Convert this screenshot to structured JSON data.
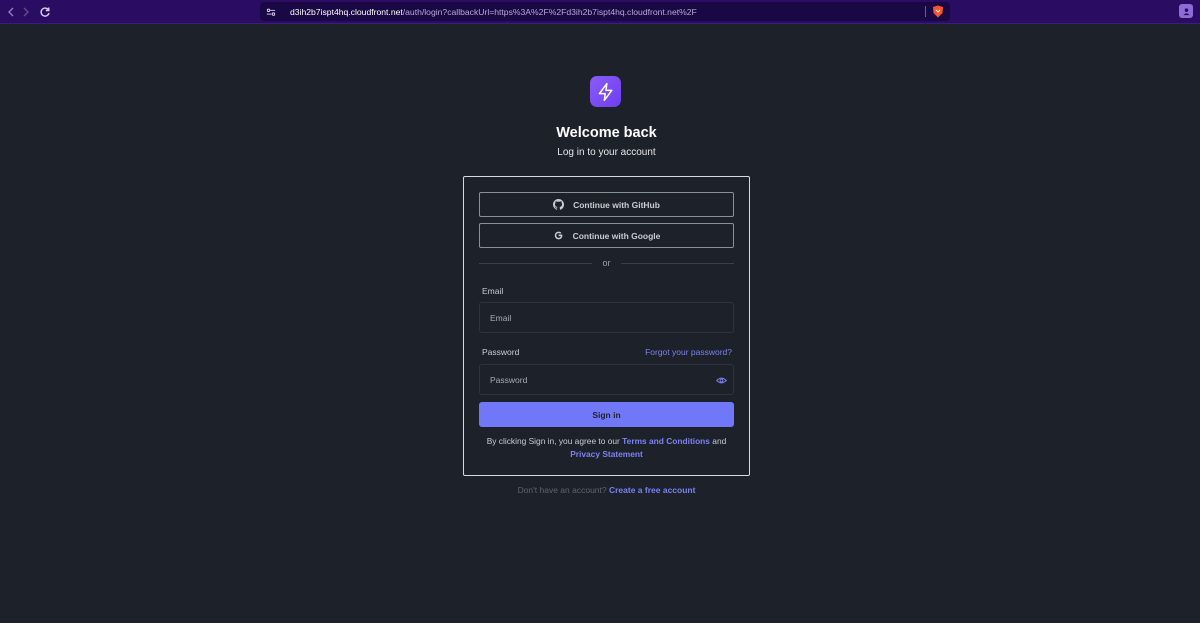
{
  "browser": {
    "url_host": "d3ih2b7ispt4hq.cloudfront.net",
    "url_path": "/auth/login?callbackUrl=https%3A%2F%2Fd3ih2b7ispt4hq.cloudfront.net%2F"
  },
  "page": {
    "title": "Welcome back",
    "subtitle": "Log in to your account"
  },
  "oauth": {
    "github_label": "Continue with GitHub",
    "google_label": "Continue with Google",
    "divider": "or"
  },
  "form": {
    "email_label": "Email",
    "email_placeholder": "Email",
    "password_label": "Password",
    "password_placeholder": "Password",
    "forgot_label": "Forgot your password?",
    "signin_label": "Sign in"
  },
  "terms": {
    "prefix": "By clicking Sign in, you agree to our ",
    "terms_link": "Terms and Conditions",
    "and": " and ",
    "privacy_link": "Privacy Statement"
  },
  "footer": {
    "prompt": "Don't have an account? ",
    "create_link": "Create a free account"
  },
  "colors": {
    "background": "#1d2129",
    "accent": "#7178f8",
    "logo": "#7c4df3",
    "browser_bar": "#2a0d63"
  },
  "icons": {
    "logo": "lightning-icon",
    "github": "github-icon",
    "google": "google-icon",
    "eye": "eye-icon"
  }
}
